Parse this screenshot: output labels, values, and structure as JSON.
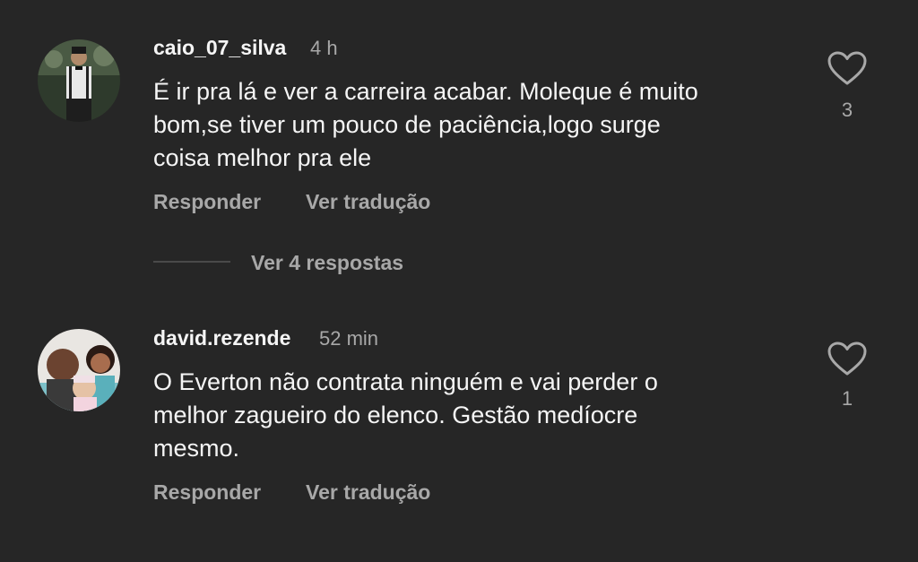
{
  "comments": [
    {
      "username": "caio_07_silva",
      "time": "4 h",
      "text_lines": [
        "É ir pra lá e ver a carreira acabar. Moleque é muito",
        "bom,se tiver um pouco de paciência,logo surge",
        "coisa melhor pra ele"
      ],
      "reply_label": "Responder",
      "translate_label": "Ver tradução",
      "likes": "3"
    },
    {
      "username": "david.rezende",
      "time": "52 min",
      "text_lines": [
        "O Everton não contrata ninguém e vai perder o",
        "melhor zagueiro do elenco. Gestão medíocre",
        "mesmo."
      ],
      "reply_label": "Responder",
      "translate_label": "Ver tradução",
      "likes": "1"
    }
  ],
  "view_replies_label": "Ver 4 respostas",
  "colors": {
    "background": "#262626",
    "primary_text": "#f5f5f5",
    "secondary_text": "#a8a8a8"
  },
  "icons": {
    "like": "heart-outline-icon"
  }
}
